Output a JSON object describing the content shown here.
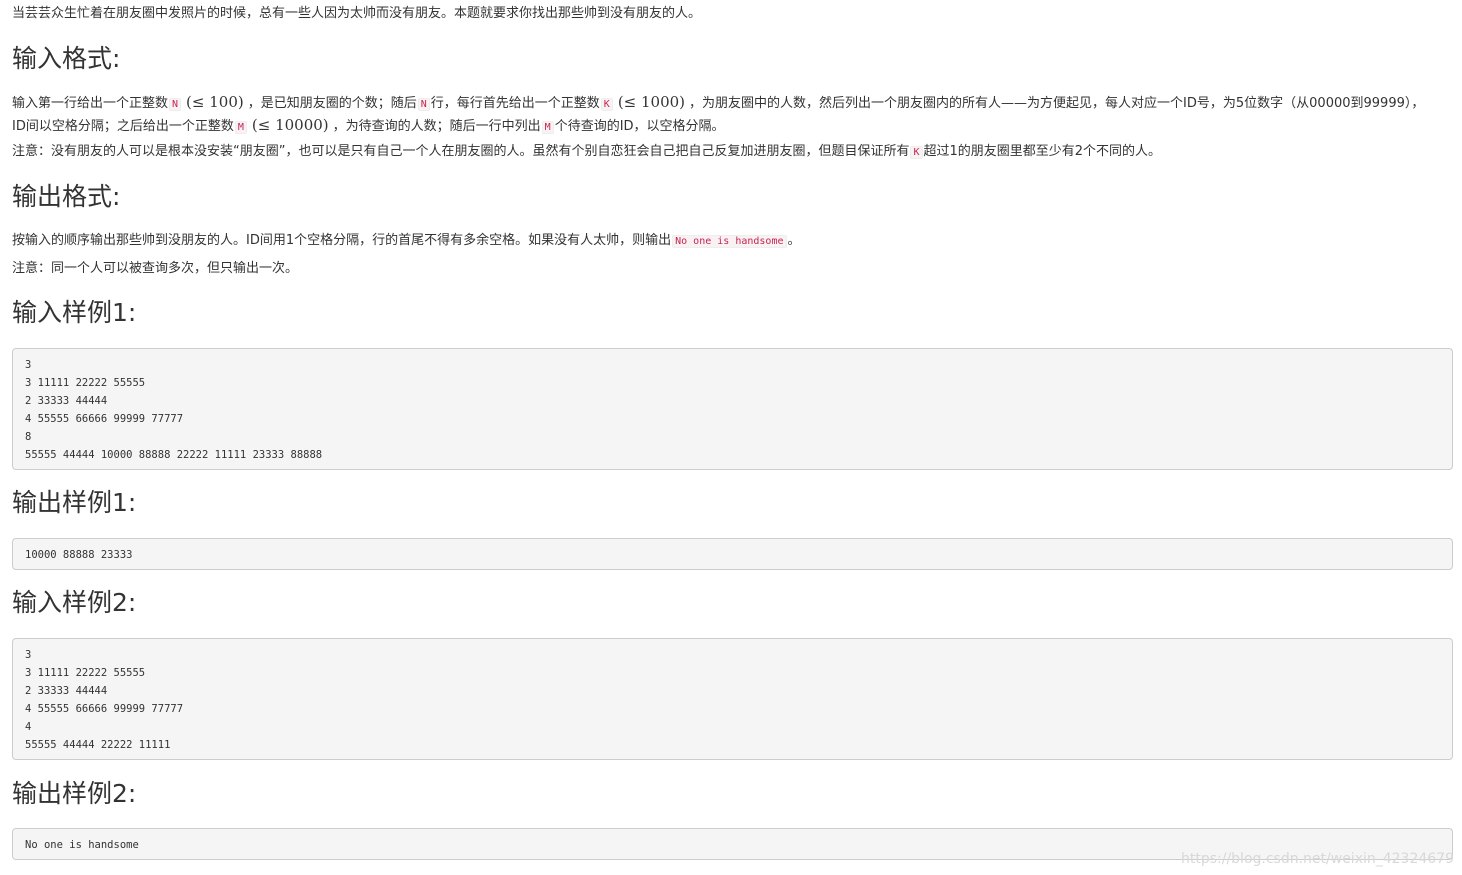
{
  "intro": "当芸芸众生忙着在朋友圈中发照片的时候，总有一些人因为太帅而没有朋友。本题就要求你找出那些帅到没有朋友的人。",
  "input_format": {
    "heading": "输入格式:",
    "p1_a": "输入第一行给出一个正整数",
    "var_N": "N",
    "math_100": "(≤ 100)",
    "p1_b": "，是已知朋友圈的个数；随后",
    "p1_c": "行，每行首先给出一个正整数",
    "var_K": "K",
    "math_1000": "(≤ 1000)",
    "p1_d": "，为朋友圈中的人数，然后列出一个朋友圈内的所有人——为方便起见，每人对应一个ID号，为5位数字（从00000到99999），ID间以空格分隔；之后给出一个正整数",
    "var_M": "M",
    "math_10000": "(≤ 10000)",
    "p1_e": "，为待查询的人数；随后一行中列出",
    "p1_f": "个待查询的ID，以空格分隔。",
    "note_a": "注意：没有朋友的人可以是根本没安装“朋友圈”，也可以是只有自己一个人在朋友圈的人。虽然有个别自恋狂会自己把自己反复加进朋友圈，但题目保证所有",
    "note_b": "超过1的朋友圈里都至少有2个不同的人。"
  },
  "output_format": {
    "heading": "输出格式:",
    "p1_a": "按输入的顺序输出那些帅到没朋友的人。ID间用1个空格分隔，行的首尾不得有多余空格。如果没有人太帅，则输出",
    "code": "No one is handsome",
    "p1_b": "。",
    "note": "注意：同一个人可以被查询多次，但只输出一次。"
  },
  "sample_input_1": {
    "heading": "输入样例1:",
    "code": "3\n3 11111 22222 55555\n2 33333 44444\n4 55555 66666 99999 77777\n8\n55555 44444 10000 88888 22222 11111 23333 88888"
  },
  "sample_output_1": {
    "heading": "输出样例1:",
    "code": "10000 88888 23333"
  },
  "sample_input_2": {
    "heading": "输入样例2:",
    "code": "3\n3 11111 22222 55555\n2 33333 44444\n4 55555 66666 99999 77777\n4\n55555 44444 22222 11111"
  },
  "sample_output_2": {
    "heading": "输出样例2:",
    "code": "No one is handsome"
  },
  "watermark": "https://blog.csdn.net/weixin_42324679"
}
